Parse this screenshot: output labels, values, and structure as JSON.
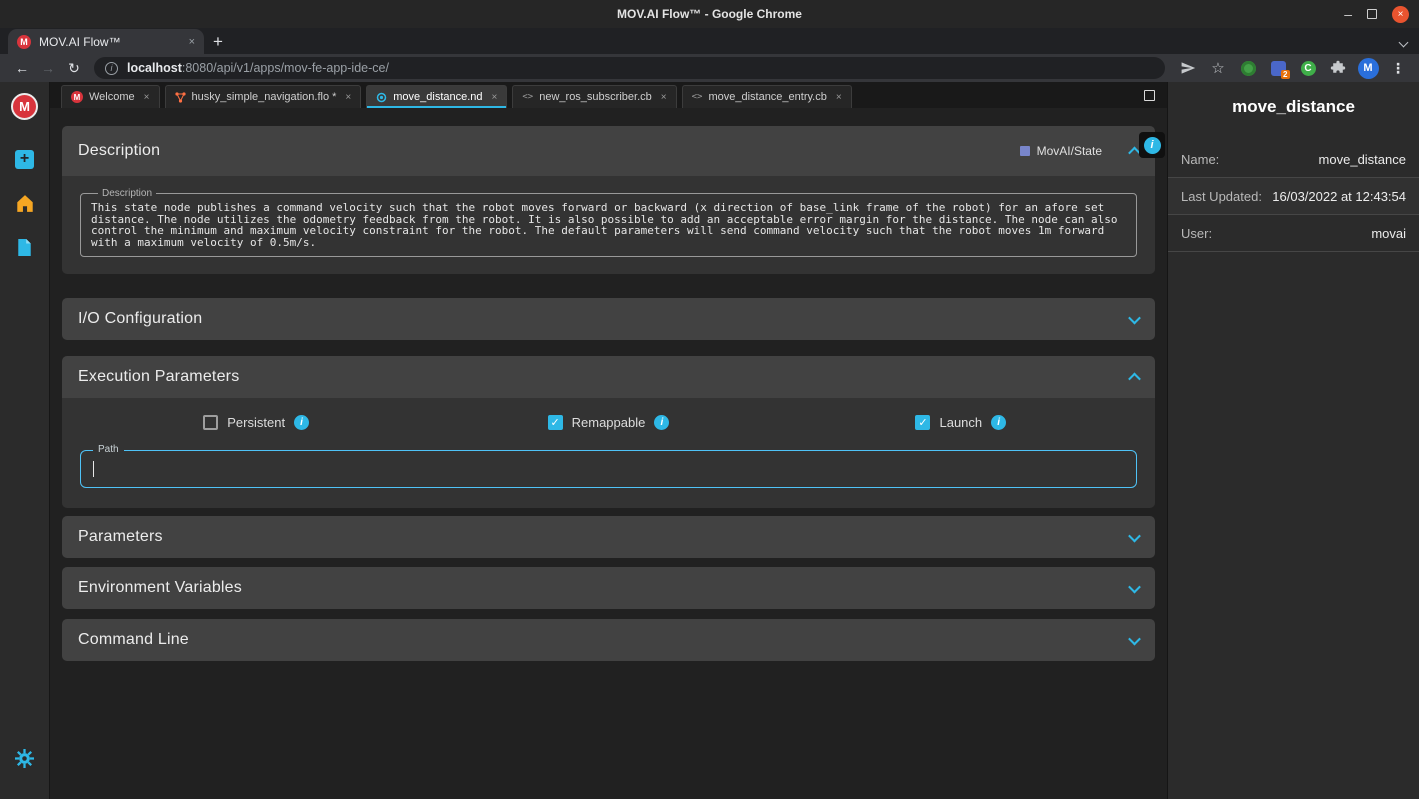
{
  "window": {
    "title": "MOV.AI Flow™ - Google Chrome"
  },
  "browser": {
    "tab_title": "MOV.AI Flow™",
    "url_host": "localhost",
    "url_rest": ":8080/api/v1/apps/mov-fe-app-ide-ce/",
    "shield_badge": "2",
    "ext_letter": "C",
    "profile_initial": "M"
  },
  "brand": {
    "logo_letter": "M"
  },
  "editor_tabs": [
    {
      "label": "Welcome"
    },
    {
      "label": "husky_simple_navigation.flo *"
    },
    {
      "label": "move_distance.nd"
    },
    {
      "label": "new_ros_subscriber.cb"
    },
    {
      "label": "move_distance_entry.cb"
    }
  ],
  "panel": {
    "type_chip": "MovAI/State",
    "description": {
      "header": "Description",
      "field_label": "Description",
      "text": "This state node publishes a command velocity such that the robot moves forward or backward (x direction of base_link frame of the robot) for an afore set distance. The node utilizes the odometry feedback from the robot. It is also possible to add an acceptable error margin for the distance. The node can also control the minimum and maximum velocity constraint for the robot. The default parameters will send command velocity such that the robot moves 1m forward with a maximum velocity of 0.5m/s."
    },
    "io": {
      "header": "I/O Configuration"
    },
    "execution": {
      "header": "Execution Parameters",
      "checkboxes": [
        {
          "label": "Persistent",
          "checked": false
        },
        {
          "label": "Remappable",
          "checked": true
        },
        {
          "label": "Launch",
          "checked": true
        }
      ],
      "path_label": "Path",
      "path_value": ""
    },
    "parameters": {
      "header": "Parameters"
    },
    "environment": {
      "header": "Environment Variables"
    },
    "command_line": {
      "header": "Command Line"
    }
  },
  "details": {
    "title": "move_distance",
    "rows": [
      {
        "label": "Name:",
        "value": "move_distance"
      },
      {
        "label": "Last Updated:",
        "value": "16/03/2022 at 12:43:54"
      },
      {
        "label": "User:",
        "value": "movai"
      }
    ]
  },
  "icons": {
    "close": "×",
    "new_tab": "+",
    "back": "←",
    "forward": "→",
    "reload": "↻",
    "star": "☆",
    "kebab": "⋮",
    "minimize": "–",
    "info": "i",
    "url_info": "i",
    "code": "<>",
    "plus": "+"
  },
  "colors": {
    "accent": "#2eb8e6",
    "path_border": "#4fc3f7",
    "logo_red": "#d8343c",
    "state_chip": "#7986cb",
    "home_orange": "#f5a623"
  }
}
